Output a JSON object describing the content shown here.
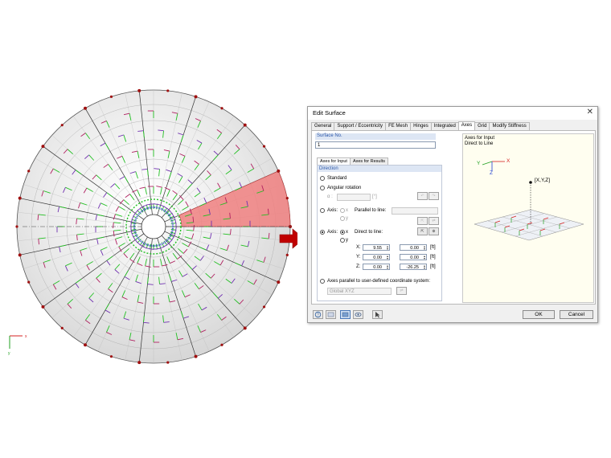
{
  "dialog": {
    "title": "Edit Surface",
    "tabs": [
      "General",
      "Support / Eccentricity",
      "FE Mesh",
      "Hinges",
      "Integrated",
      "Axes",
      "Grid",
      "Modify Stiffness"
    ],
    "active_tab": "Axes",
    "surface_no_label": "Surface No.",
    "surface_no_value": "1",
    "subtabs": [
      "Axes for Input",
      "Axes for Results"
    ],
    "direction_label": "Direction",
    "standard_label": "Standard",
    "angular_rotation_label": "Angular rotation",
    "alpha_label": "α :",
    "alpha_unit": "[°]",
    "axis1_label": "Axis:",
    "axis1_x": "x",
    "axis1_y": "y",
    "parallel_line_label": "Parallel to line:",
    "axis2_label": "Axis:",
    "axis2_x": "x",
    "axis2_y": "y",
    "direct_line_label": "Direct to line:",
    "coords": [
      {
        "label": "X:",
        "v1": "9.55",
        "v2": "0.00",
        "unit": "[ft]"
      },
      {
        "label": "Y:",
        "v1": "0.00",
        "v2": "0.00",
        "unit": "[ft]"
      },
      {
        "label": "Z:",
        "v1": "0.00",
        "v2": "-26.25",
        "unit": "[ft]"
      }
    ],
    "user_cs_label": "Axes parallel to user-defined coordinate system:",
    "user_cs_value": "Global XYZ",
    "preview_line1": "Axes for Input",
    "preview_line2": "Direct to Line",
    "preview_point_label": "[X,Y,Z]",
    "preview_axis_x": "X",
    "preview_axis_y": "Y",
    "preview_axis_z": "Z",
    "ok_label": "OK",
    "cancel_label": "Cancel"
  },
  "model": {
    "axis_x_label": "x",
    "axis_y_label": "y",
    "highlight_color": "#f08080",
    "accent_red": "#c00000"
  }
}
